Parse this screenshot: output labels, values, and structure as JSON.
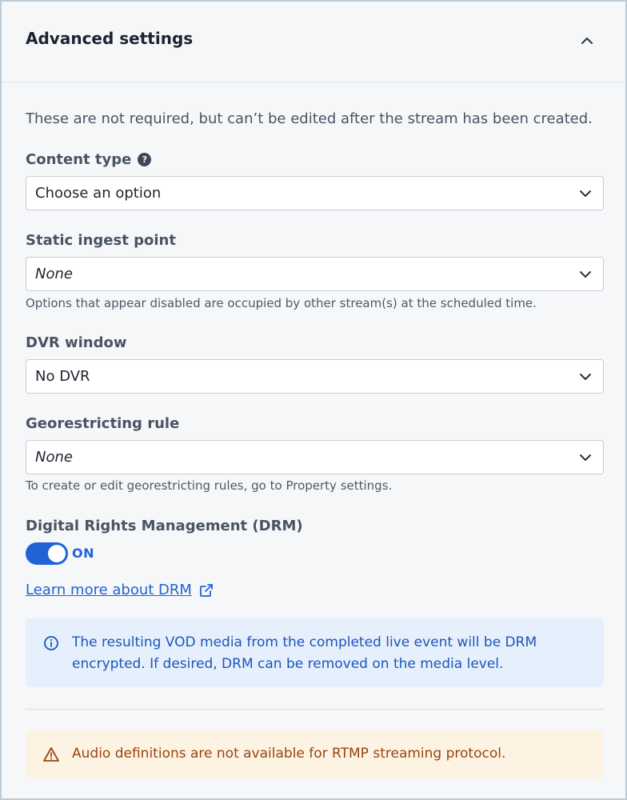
{
  "header": {
    "title": "Advanced settings",
    "collapse_icon": "chevron-up-icon"
  },
  "intro": "These are not required, but can’t be edited after the stream has been created.",
  "content_type": {
    "label": "Content type",
    "help_icon": "?",
    "value": "Choose an option"
  },
  "static_ingest": {
    "label": "Static ingest point",
    "value": "None",
    "hint": "Options that appear disabled are occupied by other stream(s) at the scheduled time."
  },
  "dvr": {
    "label": "DVR window",
    "value": "No DVR"
  },
  "georestricting": {
    "label": "Georestricting rule",
    "value": "None",
    "hint": "To create or edit georestricting rules, go to Property settings."
  },
  "drm": {
    "label": "Digital Rights Management (DRM)",
    "toggle_text": "ON",
    "link": "Learn more about DRM"
  },
  "info_message": "The resulting VOD media from the completed live event will be DRM encrypted. If desired, DRM can be removed on the media level.",
  "warning_message": "Audio definitions are not available for RTMP streaming protocol.",
  "colors": {
    "accent": "#1f63d6",
    "info_bg": "#e6f0fd",
    "warning_bg": "#fdf3e3",
    "warning_text": "#9a4410"
  }
}
